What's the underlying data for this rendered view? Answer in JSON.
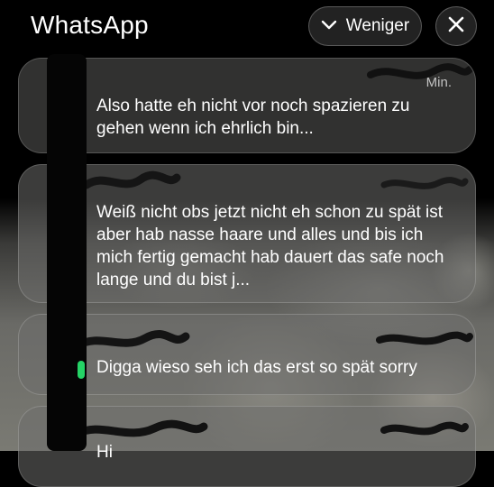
{
  "header": {
    "title": "WhatsApp",
    "less_label": "Weniger"
  },
  "notifications": [
    {
      "time": "Min.",
      "message": "Also hatte eh nicht vor noch spazieren zu gehen wenn ich ehrlich bin..."
    },
    {
      "message": "Weiß nicht obs jetzt nicht eh schon zu spät ist aber hab nasse haare und alles und bis ich mich fertig gemacht hab dauert das safe noch lange und du bist j..."
    },
    {
      "message": "Digga wieso seh ich das erst so spät sorry"
    },
    {
      "message": "Hi"
    }
  ],
  "colors": {
    "accent": "#25d366",
    "text": "#ffffff"
  }
}
